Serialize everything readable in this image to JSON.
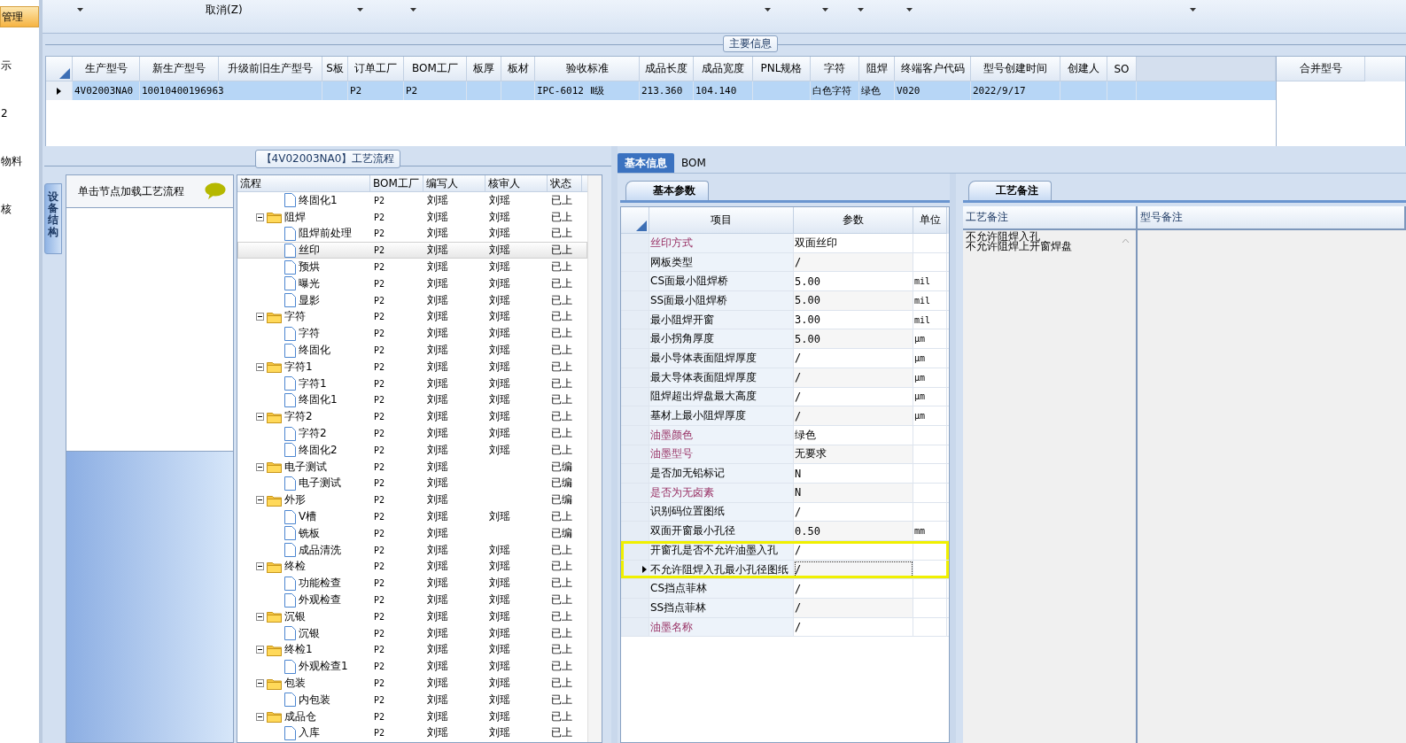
{
  "sidebar": {
    "items": [
      {
        "label": "管理",
        "selected": true
      },
      {
        "label": "示",
        "selected": false
      },
      {
        "label": "2",
        "selected": false
      },
      {
        "label": "物料",
        "selected": false
      },
      {
        "label": "核",
        "selected": false
      }
    ]
  },
  "toolbar": {
    "items": [
      {
        "kind": "dropdown"
      },
      {
        "kind": "button",
        "label": "取消(Z)"
      },
      {
        "kind": "dropdown"
      },
      {
        "kind": "dropdown"
      },
      {
        "kind": "dropdown"
      },
      {
        "kind": "dropdown"
      },
      {
        "kind": "dropdown"
      },
      {
        "kind": "dropdown"
      },
      {
        "kind": "dropdown"
      }
    ]
  },
  "main_info": {
    "title": "主要信息",
    "columns": [
      "生产型号",
      "新生产型号",
      "升级前旧生产型号",
      "S板",
      "订单工厂",
      "BOM工厂",
      "板厚",
      "板材",
      "验收标准",
      "成品长度",
      "成品宽度",
      "PNL规格",
      "字符",
      "阻焊",
      "终端客户代码",
      "型号创建时间",
      "创建人",
      "SO"
    ],
    "rows": [
      {
        "selected": true,
        "cells": [
          "4V02003NA0",
          "10010400196963",
          null,
          null,
          "P2",
          "P2",
          null,
          null,
          "IPC-6012 Ⅱ级",
          "213.360",
          "104.140",
          null,
          "白色字符",
          "绿色",
          "V020",
          "2022/9/17",
          null,
          null
        ]
      }
    ],
    "side_table": {
      "columns": [
        "合并型号"
      ]
    }
  },
  "process_flow": {
    "title": "【4V02003NA0】工艺流程",
    "side_tab": "设备结构",
    "hint": "单击节点加载工艺流程",
    "columns": [
      "流程",
      "BOM工厂",
      "编写人",
      "核审人",
      "状态"
    ],
    "nodes": [
      {
        "children": [
          {
            "kind": "file",
            "label": "终固化1",
            "factory": "P2",
            "writer": "刘瑶",
            "reviewer": "刘瑶",
            "status": "已上",
            "selected": false
          }
        ]
      },
      {
        "kind": "folder",
        "label": "阻焊",
        "factory": "P2",
        "writer": "刘瑶",
        "reviewer": "刘瑶",
        "status": "已上",
        "selected": false,
        "expanded": true,
        "children": [
          {
            "kind": "file",
            "label": "阻焊前处理",
            "factory": "P2",
            "writer": "刘瑶",
            "reviewer": "刘瑶",
            "status": "已上",
            "selected": false
          },
          {
            "kind": "file",
            "label": "丝印",
            "factory": "P2",
            "writer": "刘瑶",
            "reviewer": "刘瑶",
            "status": "已上",
            "selected": true
          },
          {
            "kind": "file",
            "label": "预烘",
            "factory": "P2",
            "writer": "刘瑶",
            "reviewer": "刘瑶",
            "status": "已上",
            "selected": false
          },
          {
            "kind": "file",
            "label": "曝光",
            "factory": "P2",
            "writer": "刘瑶",
            "reviewer": "刘瑶",
            "status": "已上",
            "selected": false
          },
          {
            "kind": "file",
            "label": "显影",
            "factory": "P2",
            "writer": "刘瑶",
            "reviewer": "刘瑶",
            "status": "已上",
            "selected": false
          }
        ]
      },
      {
        "kind": "folder",
        "label": "字符",
        "factory": "P2",
        "writer": "刘瑶",
        "reviewer": "刘瑶",
        "status": "已上",
        "selected": false,
        "expanded": true,
        "children": [
          {
            "kind": "file",
            "label": "字符",
            "factory": "P2",
            "writer": "刘瑶",
            "reviewer": "刘瑶",
            "status": "已上",
            "selected": false
          },
          {
            "kind": "file",
            "label": "终固化",
            "factory": "P2",
            "writer": "刘瑶",
            "reviewer": "刘瑶",
            "status": "已上",
            "selected": false
          }
        ]
      },
      {
        "kind": "folder",
        "label": "字符1",
        "factory": "P2",
        "writer": "刘瑶",
        "reviewer": "刘瑶",
        "status": "已上",
        "selected": false,
        "expanded": true,
        "children": [
          {
            "kind": "file",
            "label": "字符1",
            "factory": "P2",
            "writer": "刘瑶",
            "reviewer": "刘瑶",
            "status": "已上",
            "selected": false
          },
          {
            "kind": "file",
            "label": "终固化1",
            "factory": "P2",
            "writer": "刘瑶",
            "reviewer": "刘瑶",
            "status": "已上",
            "selected": false
          }
        ]
      },
      {
        "kind": "folder",
        "label": "字符2",
        "factory": "P2",
        "writer": "刘瑶",
        "reviewer": "刘瑶",
        "status": "已上",
        "selected": false,
        "expanded": true,
        "children": [
          {
            "kind": "file",
            "label": "字符2",
            "factory": "P2",
            "writer": "刘瑶",
            "reviewer": "刘瑶",
            "status": "已上",
            "selected": false
          },
          {
            "kind": "file",
            "label": "终固化2",
            "factory": "P2",
            "writer": "刘瑶",
            "reviewer": "刘瑶",
            "status": "已上",
            "selected": false
          }
        ]
      },
      {
        "kind": "folder",
        "label": "电子测试",
        "factory": "P2",
        "writer": "刘瑶",
        "status": "已编",
        "selected": false,
        "expanded": true,
        "children": [
          {
            "kind": "file",
            "label": "电子测试",
            "factory": "P2",
            "writer": "刘瑶",
            "status": "已编",
            "selected": false
          }
        ]
      },
      {
        "kind": "folder",
        "label": "外形",
        "factory": "P2",
        "writer": "刘瑶",
        "status": "已编",
        "selected": false,
        "expanded": true,
        "children": [
          {
            "kind": "file",
            "label": "V槽",
            "factory": "P2",
            "writer": "刘瑶",
            "reviewer": "刘瑶",
            "status": "已上",
            "selected": false
          },
          {
            "kind": "file",
            "label": "铣板",
            "factory": "P2",
            "writer": "刘瑶",
            "status": "已编",
            "selected": false
          },
          {
            "kind": "file",
            "label": "成品清洗",
            "factory": "P2",
            "writer": "刘瑶",
            "reviewer": "刘瑶",
            "status": "已上",
            "selected": false
          }
        ]
      },
      {
        "kind": "folder",
        "label": "终检",
        "factory": "P2",
        "writer": "刘瑶",
        "reviewer": "刘瑶",
        "status": "已上",
        "selected": false,
        "expanded": true,
        "children": [
          {
            "kind": "file",
            "label": "功能检查",
            "factory": "P2",
            "writer": "刘瑶",
            "reviewer": "刘瑶",
            "status": "已上",
            "selected": false
          },
          {
            "kind": "file",
            "label": "外观检查",
            "factory": "P2",
            "writer": "刘瑶",
            "reviewer": "刘瑶",
            "status": "已上",
            "selected": false
          }
        ]
      },
      {
        "kind": "folder",
        "label": "沉银",
        "factory": "P2",
        "writer": "刘瑶",
        "reviewer": "刘瑶",
        "status": "已上",
        "selected": false,
        "expanded": true,
        "children": [
          {
            "kind": "file",
            "label": "沉银",
            "factory": "P2",
            "writer": "刘瑶",
            "reviewer": "刘瑶",
            "status": "已上",
            "selected": false
          }
        ]
      },
      {
        "kind": "folder",
        "label": "终检1",
        "factory": "P2",
        "writer": "刘瑶",
        "reviewer": "刘瑶",
        "status": "已上",
        "selected": false,
        "expanded": true,
        "children": [
          {
            "kind": "file",
            "label": "外观检查1",
            "factory": "P2",
            "writer": "刘瑶",
            "reviewer": "刘瑶",
            "status": "已上",
            "selected": false
          }
        ]
      },
      {
        "kind": "folder",
        "label": "包装",
        "factory": "P2",
        "writer": "刘瑶",
        "reviewer": "刘瑶",
        "status": "已上",
        "selected": false,
        "expanded": true,
        "children": [
          {
            "kind": "file",
            "label": "内包装",
            "factory": "P2",
            "writer": "刘瑶",
            "reviewer": "刘瑶",
            "status": "已上",
            "selected": false
          }
        ]
      },
      {
        "kind": "folder",
        "label": "成品仓",
        "factory": "P2",
        "writer": "刘瑶",
        "reviewer": "刘瑶",
        "status": "已上",
        "selected": false,
        "expanded": true,
        "children": [
          {
            "kind": "file",
            "label": "入库",
            "factory": "P2",
            "writer": "刘瑶",
            "reviewer": "刘瑶",
            "status": "已上",
            "selected": false
          }
        ]
      }
    ]
  },
  "detail_tabs": [
    {
      "label": "基本信息",
      "selected": true
    },
    {
      "label": "BOM",
      "selected": false
    }
  ],
  "params": {
    "tab": "基本参数",
    "columns": [
      "项目",
      "参数",
      "单位"
    ],
    "rows": [
      {
        "item": "丝印方式",
        "value": "双面丝印",
        "required": true,
        "highlighted": false,
        "selected": false
      },
      {
        "item": "网板类型",
        "value": "/",
        "required": false,
        "highlighted": false,
        "selected": false
      },
      {
        "item": "CS面最小阻焊桥",
        "value": "5.00",
        "unit": "mil",
        "required": false,
        "highlighted": false,
        "selected": false
      },
      {
        "item": "SS面最小阻焊桥",
        "value": "5.00",
        "unit": "mil",
        "required": false,
        "highlighted": false,
        "selected": false
      },
      {
        "item": "最小阻焊开窗",
        "value": "3.00",
        "unit": "mil",
        "required": false,
        "highlighted": false,
        "selected": false
      },
      {
        "item": "最小拐角厚度",
        "value": "5.00",
        "unit": "μm",
        "required": false,
        "highlighted": false,
        "selected": false
      },
      {
        "item": "最小导体表面阻焊厚度",
        "value": "/",
        "unit": "μm",
        "required": false,
        "highlighted": false,
        "selected": false
      },
      {
        "item": "最大导体表面阻焊厚度",
        "value": "/",
        "unit": "μm",
        "required": false,
        "highlighted": false,
        "selected": false
      },
      {
        "item": "阻焊超出焊盘最大高度",
        "value": "/",
        "unit": "μm",
        "required": false,
        "highlighted": false,
        "selected": false
      },
      {
        "item": "基材上最小阻焊厚度",
        "value": "/",
        "unit": "μm",
        "required": false,
        "highlighted": false,
        "selected": false
      },
      {
        "item": "油墨颜色",
        "value": "绿色",
        "required": true,
        "highlighted": false,
        "selected": false
      },
      {
        "item": "油墨型号",
        "value": "无要求",
        "required": true,
        "highlighted": false,
        "selected": false
      },
      {
        "item": "是否加无铅标记",
        "value": "N",
        "required": false,
        "highlighted": false,
        "selected": false
      },
      {
        "item": "是否为无卤素",
        "value": "N",
        "required": true,
        "highlighted": false,
        "selected": false
      },
      {
        "item": "识别码位置图纸",
        "value": "/",
        "required": false,
        "highlighted": false,
        "selected": false
      },
      {
        "item": "双面开窗最小孔径",
        "value": "0.50",
        "unit": "mm",
        "required": false,
        "highlighted": false,
        "selected": false
      },
      {
        "item": "开窗孔是否不允许油墨入孔",
        "value": "/",
        "required": false,
        "highlighted": true,
        "selected": false
      },
      {
        "item": "不允许阻焊入孔最小孔径图纸",
        "value": "/",
        "required": false,
        "highlighted": true,
        "selected": true
      },
      {
        "item": "CS挡点菲林",
        "value": "/",
        "required": false,
        "highlighted": false,
        "selected": false
      },
      {
        "item": "SS挡点菲林",
        "value": "/",
        "required": false,
        "highlighted": false,
        "selected": false
      },
      {
        "item": "油墨名称",
        "value": "/",
        "required": true,
        "highlighted": false,
        "selected": false
      }
    ]
  },
  "remarks": {
    "tab": "工艺备注",
    "columns": [
      "工艺备注",
      "型号备注"
    ],
    "process_note": [
      "不允许阻焊入孔",
      "不允许阻焊上开窗焊盘"
    ]
  }
}
